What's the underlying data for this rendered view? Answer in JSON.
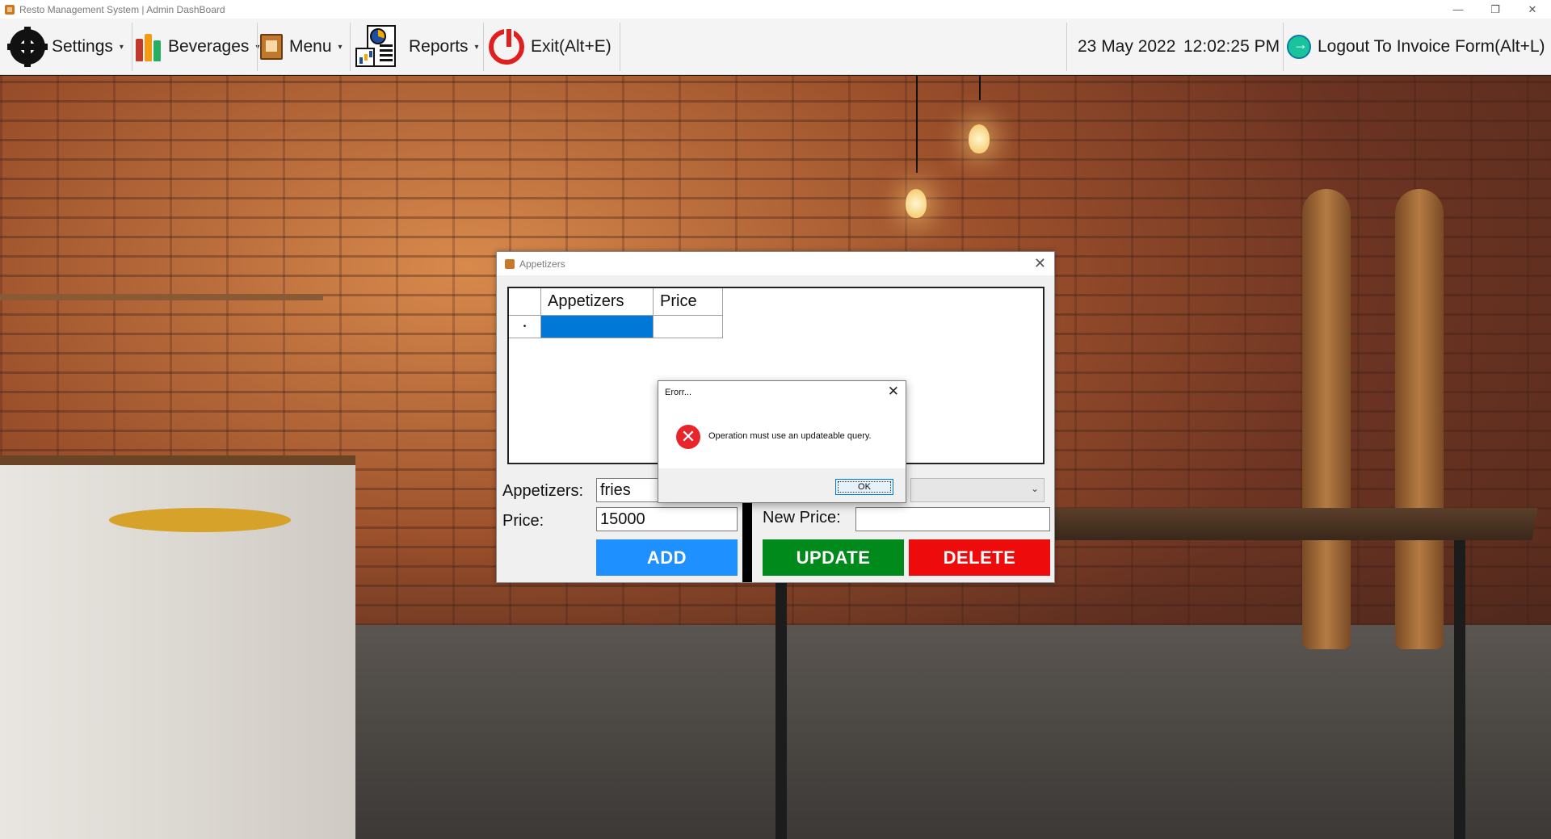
{
  "window": {
    "title": "Resto Management System  | Admin DashBoard",
    "minimize_glyph": "—",
    "restore_glyph": "❐",
    "close_glyph": "✕"
  },
  "toolbar": {
    "settings_label": "Settings",
    "beverages_label": "Beverages",
    "menu_label": "Menu",
    "reports_label": "Reports",
    "exit_label": "Exit(Alt+E)",
    "date": "23 May 2022",
    "time": "12:02:25 PM",
    "logout_label": "Logout To Invoice Form(Alt+L)",
    "caret": "▾"
  },
  "appetizers_window": {
    "title": "Appetizers",
    "close_glyph": "✕",
    "grid": {
      "columns": [
        "Appetizers",
        "Price"
      ],
      "new_row_marker": "•",
      "rows": [
        {
          "appetizer": "",
          "price": ""
        }
      ]
    },
    "appetizers_label": "Appetizers:",
    "appetizers_value": "fries",
    "price_label": "Price:",
    "price_value": "15000",
    "new_price_label": "New Price:",
    "new_price_value": "",
    "combo_arrow": "⌄",
    "add_button": "ADD",
    "update_button": "UPDATE",
    "delete_button": "DELETE"
  },
  "error_dialog": {
    "title": "Erorr...",
    "close_glyph": "✕",
    "icon": "error-icon",
    "icon_glyph": "✕",
    "message": "Operation must use an updateable query.",
    "ok_button": "OK"
  },
  "colors": {
    "add": "#1e90ff",
    "update": "#008a1c",
    "delete": "#ee0b0b",
    "selection": "#0078d7",
    "error_icon": "#e8252b"
  }
}
